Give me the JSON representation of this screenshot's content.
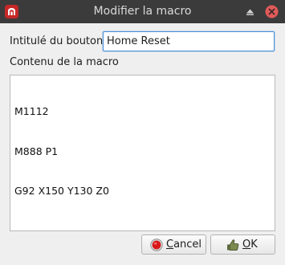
{
  "window": {
    "title": "Modifier la macro",
    "icons": {
      "app": "app-logo-icon",
      "maximize": "maximize-triangle-icon",
      "close": "close-x-icon"
    },
    "colors": {
      "titlebar": "#3b3b3b",
      "close_button": "#e05a5a",
      "accent": "#4a90d9"
    }
  },
  "form": {
    "button_title_label": "Intitulé du bouton :",
    "button_title_value": "Home Reset",
    "macro_content_label": "Contenu de la macro",
    "macro_lines": [
      "M1112",
      "M888 P1",
      "G92 X150 Y130 Z0"
    ]
  },
  "buttons": {
    "cancel": {
      "mnemonic": "C",
      "rest": "ancel",
      "icon": "red-circle-icon"
    },
    "ok": {
      "mnemonic": "O",
      "rest": "K",
      "icon": "thumbs-up-icon"
    }
  }
}
